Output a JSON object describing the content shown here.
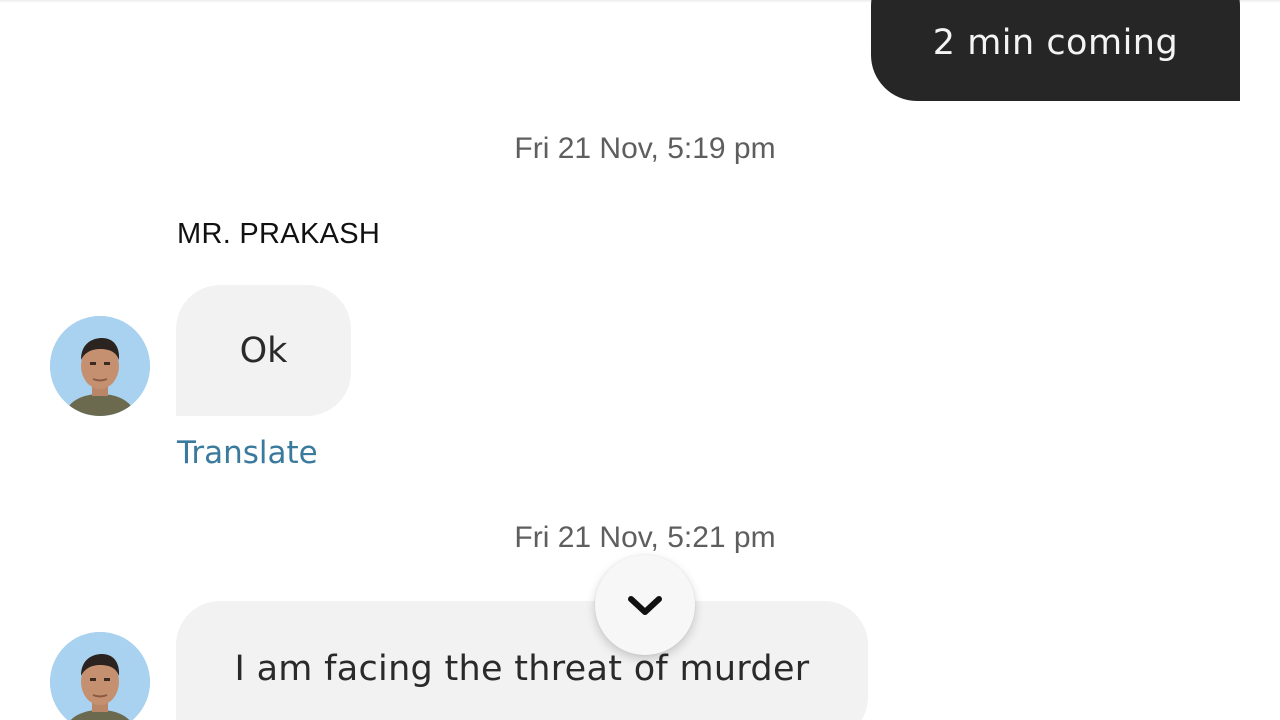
{
  "messages": {
    "outgoing_1": "2 min coming",
    "timestamp_1": "Fri 21 Nov, 5:19 pm",
    "sender_name": "MR. PRAKASH",
    "incoming_1": "Ok",
    "translate_label": "Translate",
    "timestamp_2": "Fri 21 Nov, 5:21 pm",
    "incoming_2": "I am facing the threat of murder"
  },
  "icons": {
    "scroll_down": "chevron-down-icon",
    "avatar": "avatar-photo"
  },
  "colors": {
    "outgoing_bubble": "#262626",
    "incoming_bubble": "#f2f2f2",
    "link": "#3a7a9c",
    "timestamp": "#5e5e5e"
  }
}
